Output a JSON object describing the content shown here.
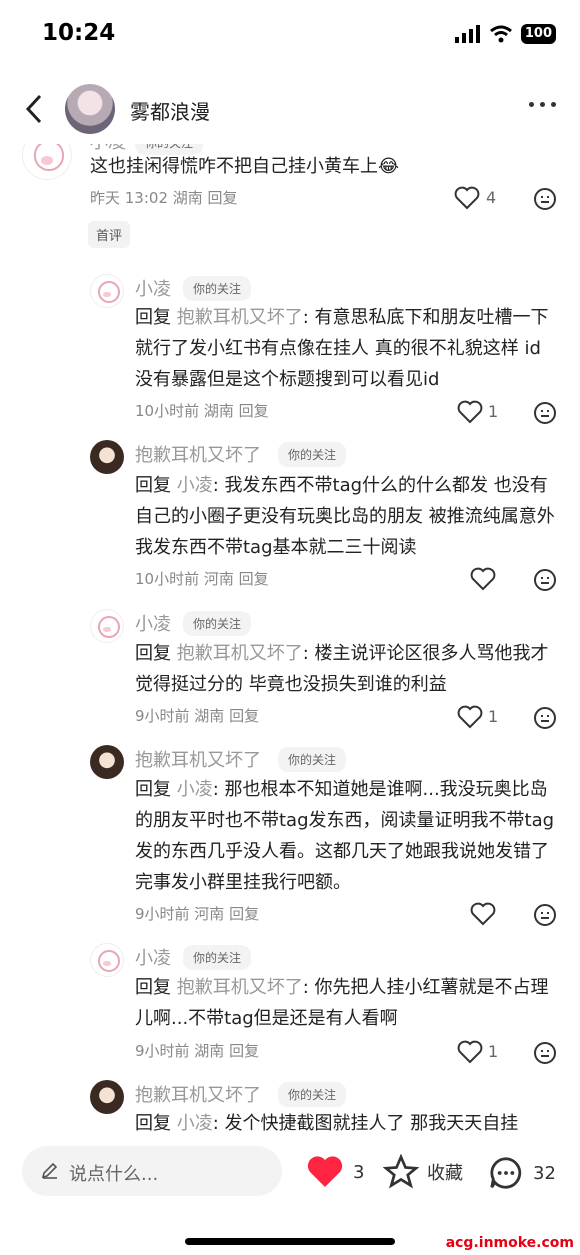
{
  "status": {
    "time": "10:24",
    "battery": "100"
  },
  "header": {
    "name": "雾都浪漫"
  },
  "top_comment": {
    "name": "小凌",
    "tag": "你的关注",
    "text": "这也挂闲得慌咋不把自己挂小黄车上😂",
    "meta": "昨天 13:02 湖南  回复",
    "likes": "4",
    "label": "首评"
  },
  "replies": [
    {
      "name": "小凌",
      "tag": "你的关注",
      "prefix": "回复 ",
      "to": "抱歉耳机又坏了",
      "text": ": 有意思私底下和朋友吐槽一下就行了发小红书有点像在挂人 真的很不礼貌这样 id没有暴露但是这个标题搜到可以看见id",
      "meta": "10小时前 湖南  回复",
      "likes": "1"
    },
    {
      "name": "抱歉耳机又坏了",
      "tag": "你的关注",
      "prefix": "回复 ",
      "to": "小凌",
      "text": ": 我发东西不带tag什么的什么都发 也没有自己的小圈子更没有玩奥比岛的朋友 被推流纯属意外 我发东西不带tag基本就二三十阅读",
      "meta": "10小时前 河南  回复",
      "likes": ""
    },
    {
      "name": "小凌",
      "tag": "你的关注",
      "prefix": "回复 ",
      "to": "抱歉耳机又坏了",
      "text": ": 楼主说评论区很多人骂他我才觉得挺过分的 毕竟也没损失到谁的利益",
      "meta": "9小时前 湖南  回复",
      "likes": "1"
    },
    {
      "name": "抱歉耳机又坏了",
      "tag": "你的关注",
      "prefix": "回复 ",
      "to": "小凌",
      "text": ": 那也根本不知道她是谁啊...我没玩奥比岛的朋友平时也不带tag发东西，阅读量证明我不带tag发的东西几乎没人看。这都几天了她跟我说她发错了完事发小群里挂我行吧额。",
      "meta": "9小时前 河南  回复",
      "likes": ""
    },
    {
      "name": "小凌",
      "tag": "你的关注",
      "prefix": "回复 ",
      "to": "抱歉耳机又坏了",
      "text": ": 你先把人挂小红薯就是不占理儿啊...不带tag但是还是有人看啊",
      "meta": "9小时前 湖南  回复",
      "likes": "1"
    },
    {
      "name": "抱歉耳机又坏了",
      "tag": "你的关注",
      "prefix": "回复 ",
      "to": "小凌",
      "text": ": 发个快捷截图就挂人了 那我天天自挂",
      "meta": "",
      "likes": ""
    }
  ],
  "bottom": {
    "placeholder": "说点什么...",
    "likes": "3",
    "favorite": "收藏",
    "comments": "32"
  },
  "watermark": "acg.inmoke.com",
  "colors": {
    "like_red": "#ff2442"
  }
}
